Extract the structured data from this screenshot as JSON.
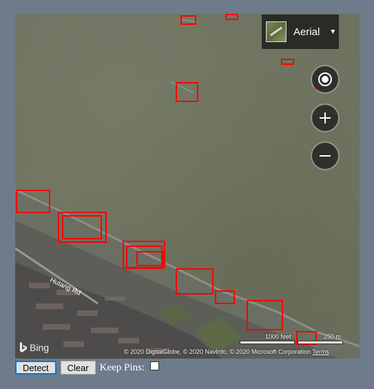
{
  "map": {
    "layer_label": "Aerial",
    "road_label": "Hutang Rd",
    "bing_label": "Bing",
    "copyright": "© 2020 DigitalGlobe, © 2020 NavInfo, © 2020 Microsoft Corporation",
    "terms": "Terms",
    "scale_feet": "1000 feet",
    "scale_meters": "250 m",
    "box_color": "#ff0000",
    "detections": 16
  },
  "controls": {
    "detect_label": "Detect",
    "clear_label": "Clear",
    "keep_pins_label": "Keep Pins:",
    "keep_pins_checked": false
  }
}
